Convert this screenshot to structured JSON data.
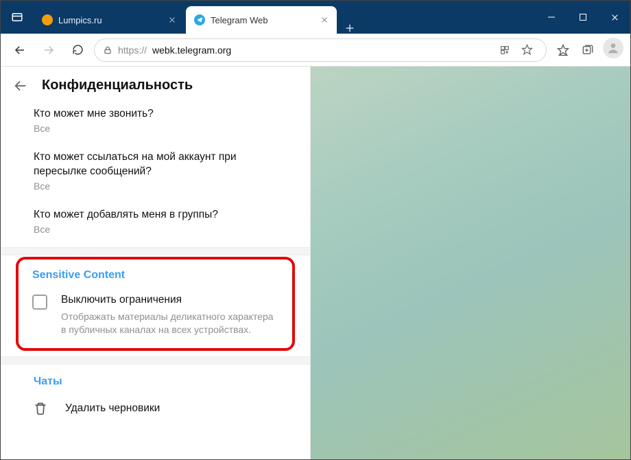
{
  "titlebar": {
    "tabs": [
      {
        "label": "Lumpics.ru",
        "active": false
      },
      {
        "label": "Telegram Web",
        "active": true
      }
    ]
  },
  "address": {
    "scheme": "https://",
    "host": "webk.telegram.org"
  },
  "panel": {
    "title": "Конфиденциальность",
    "rows": [
      {
        "label": "Кто может мне звонить?",
        "value": "Все"
      },
      {
        "label": "Кто может ссылаться на мой аккаунт при пересылке сообщений?",
        "value": "Все"
      },
      {
        "label": "Кто может добавлять меня в группы?",
        "value": "Все"
      }
    ]
  },
  "sensitive": {
    "title": "Sensitive Content",
    "check_label": "Выключить ограничения",
    "check_desc": "Отображать материалы деликатного характера в публичных каналах на всех устройствах."
  },
  "chats": {
    "title": "Чаты",
    "delete_drafts": "Удалить черновики"
  }
}
